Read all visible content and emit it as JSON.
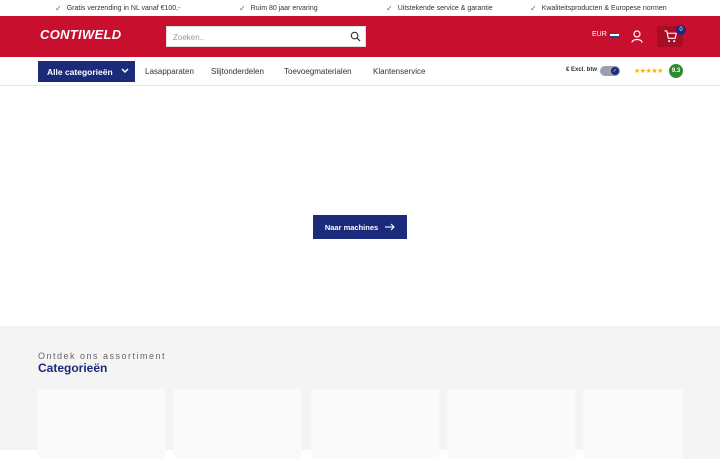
{
  "usps": [
    {
      "text": "Gratis verzending in NL vanaf €100,-"
    },
    {
      "text": "Ruim 80 jaar ervaring"
    },
    {
      "text": "Uitstekende service & garantie"
    },
    {
      "text": "Kwaliteitsproducten & Europese normen"
    }
  ],
  "header": {
    "logo": "CONTIWELD",
    "search_placeholder": "Zoeken..",
    "currency": "EUR",
    "cart_count": "0"
  },
  "nav": {
    "all_categories": "Alle categorieën",
    "links": [
      "Lasapparaten",
      "Slijtonderdelen",
      "Toevoegmaterialen",
      "Klantenservice"
    ],
    "tax_toggle_label": "€ Excl. btw",
    "stars": "★★★★★",
    "rating": "9.3"
  },
  "hero": {
    "cta_label": "Naar machines"
  },
  "categories": {
    "kicker": "Ontdek ons assortiment",
    "title": "Categorieën"
  },
  "colors": {
    "brand_red": "#c8102e",
    "brand_navy": "#1b2a7a",
    "check_green": "#2e8b2e"
  }
}
